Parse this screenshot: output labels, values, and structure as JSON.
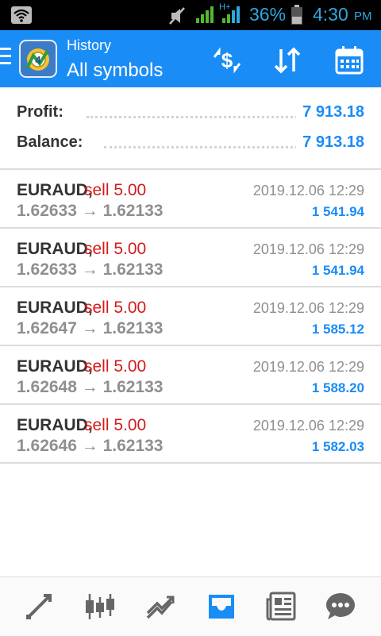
{
  "status_bar": {
    "battery_percent": "36%",
    "time": "4:30",
    "ampm": "PM",
    "network_label": "H+"
  },
  "app_bar": {
    "subtitle": "History",
    "title": "All symbols",
    "icons": [
      "menu-icon",
      "metatrader4-logo",
      "currency-exchange-icon",
      "sort-icon",
      "calendar-icon"
    ]
  },
  "summary": {
    "profit_label": "Profit:",
    "profit_value": "7 913.18",
    "balance_label": "Balance:",
    "balance_value": "7 913.18"
  },
  "deals": [
    {
      "symbol": "EURAUD,",
      "side": "sell 5.00",
      "prices": "1.62633 → 1.62133",
      "time": "2019.12.06 12:29",
      "profit": "1 541.94"
    },
    {
      "symbol": "EURAUD,",
      "side": "sell 5.00",
      "prices": "1.62633 → 1.62133",
      "time": "2019.12.06 12:29",
      "profit": "1 541.94"
    },
    {
      "symbol": "EURAUD,",
      "side": "sell 5.00",
      "prices": "1.62647 → 1.62133",
      "time": "2019.12.06 12:29",
      "profit": "1 585.12"
    },
    {
      "symbol": "EURAUD,",
      "side": "sell 5.00",
      "prices": "1.62648 → 1.62133",
      "time": "2019.12.06 12:29",
      "profit": "1 588.20"
    },
    {
      "symbol": "EURAUD,",
      "side": "sell 5.00",
      "prices": "1.62646 → 1.62133",
      "time": "2019.12.06 12:29",
      "profit": "1 582.03"
    }
  ],
  "bottom_nav": [
    "quotes-icon",
    "chart-icon",
    "trade-icon",
    "history-icon",
    "news-icon",
    "messages-icon"
  ],
  "colors": {
    "accent": "#1a8cf5",
    "sell": "#d31b1b",
    "status_bar": "#000000",
    "active_nav": "#1a8cf5",
    "inactive_nav": "#666666"
  }
}
